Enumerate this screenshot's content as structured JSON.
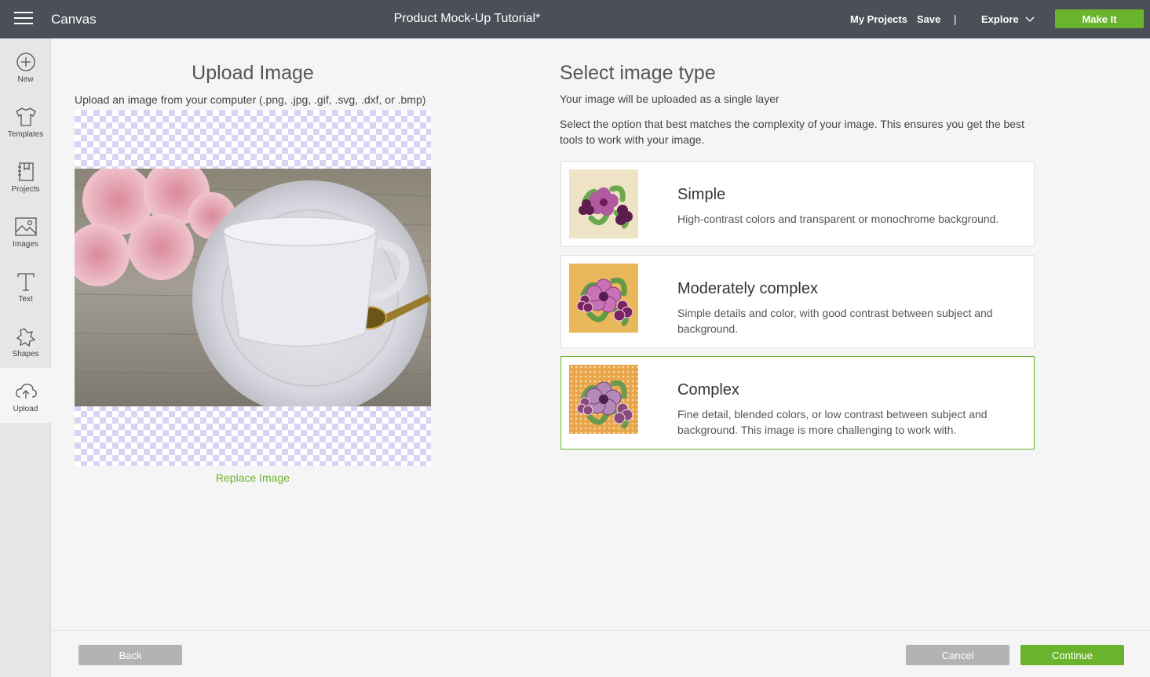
{
  "header": {
    "app_title": "Canvas",
    "doc_title": "Product Mock-Up Tutorial*",
    "my_projects": "My Projects",
    "save": "Save",
    "separator": "|",
    "explore": "Explore",
    "make_it": "Make It"
  },
  "sidebar": {
    "items": [
      {
        "label": "New",
        "icon": "plus-circle-icon"
      },
      {
        "label": "Templates",
        "icon": "tshirt-icon"
      },
      {
        "label": "Projects",
        "icon": "notebook-icon"
      },
      {
        "label": "Images",
        "icon": "image-icon"
      },
      {
        "label": "Text",
        "icon": "text-icon"
      },
      {
        "label": "Shapes",
        "icon": "shapes-icon"
      },
      {
        "label": "Upload",
        "icon": "cloud-upload-icon",
        "active": true
      }
    ]
  },
  "upload": {
    "title": "Upload Image",
    "description": "Upload an image from your computer (.png, .jpg, .gif, .svg, .dxf, or .bmp)",
    "replace_label": "Replace Image"
  },
  "image_type": {
    "title": "Select image type",
    "single_layer": "Your image will be uploaded as a single layer",
    "description": "Select the option that best matches the complexity of your image. This ensures you get the best tools to work with your image.",
    "options": [
      {
        "title": "Simple",
        "description": "High-contrast colors and transparent or monochrome background.",
        "selected": false
      },
      {
        "title": "Moderately complex",
        "description": "Simple details and color, with good contrast between subject and background.",
        "selected": false
      },
      {
        "title": "Complex",
        "description": "Fine detail, blended colors, or low contrast between subject and background. This image is more challenging to work with.",
        "selected": true
      }
    ]
  },
  "footer": {
    "back": "Back",
    "cancel": "Cancel",
    "continue": "Continue"
  },
  "colors": {
    "accent": "#6ab42d",
    "topbar": "#4a4f58",
    "button_gray": "#b3b3b3"
  }
}
